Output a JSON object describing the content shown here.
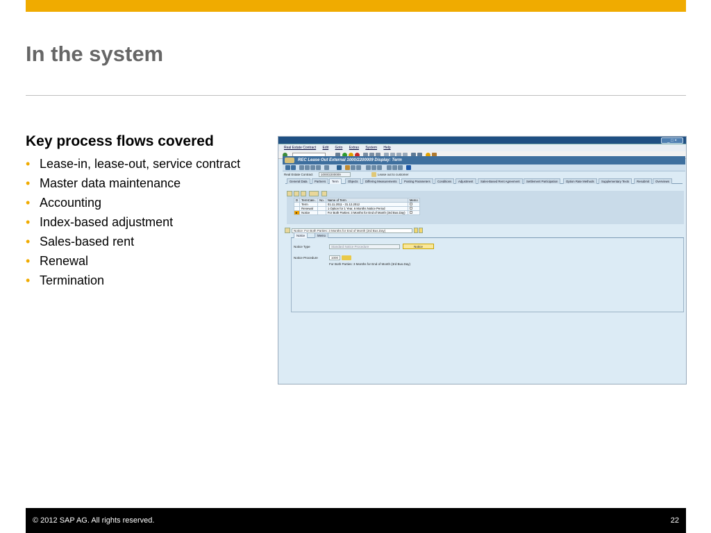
{
  "slide": {
    "title": "In the system",
    "section_title": "Key process flows covered",
    "bullets": [
      "Lease-in, lease-out, service contract",
      "Master data maintenance",
      "Accounting",
      "Index-based adjustment",
      "Sales-based rent",
      "Renewal",
      "Termination"
    ],
    "footer": {
      "copyright": "©  2012 SAP AG. All rights reserved.",
      "page": "22"
    },
    "colors": {
      "accent": "#f0ab00",
      "title": "#666666",
      "footer_bg": "#000000"
    }
  },
  "sap": {
    "menu": [
      "Real Estate Contract",
      "Edit",
      "Goto",
      "Extras",
      "System",
      "Help"
    ],
    "app_title": "REC Lease Out External 1000/2200009 Display: Term",
    "contract": {
      "label": "Real Estate Contract",
      "value": "1000/2200009",
      "description": "Lease out to customer"
    },
    "tabs": [
      "General Data",
      "Partners",
      "Term",
      "Objects",
      "Differing Measurements",
      "Posting Parameters",
      "Conditions",
      "Adjustment",
      "Sales-Based Rent Agreement",
      "Settlement Participation",
      "Option Rate Methods",
      "Supplementary Texts",
      "Resubmit",
      "Overviews"
    ],
    "active_tab": "Term",
    "table": {
      "headers": [
        "D",
        "TermCate..",
        "No.",
        "Name of Term",
        "Memo"
      ],
      "rows": [
        [
          "",
          "Term",
          "",
          "01.11.2011 - 31.12.2012",
          ""
        ],
        [
          "",
          "Renewal",
          "",
          "1 Option for 1 Year, 6 Months Notice Period",
          ""
        ],
        [
          "",
          "Notice",
          "",
          "For Both Parties: 3 Months for End of Month (3rd Bus.Day)",
          ""
        ]
      ]
    },
    "selector_value": "Notice: For Both Parties: 3 Months for End of Month (3rd Bus.Day)",
    "sub_tabs": [
      "Notice",
      "Memo"
    ],
    "notice_type": {
      "label": "Notice Type",
      "value": "Standard Notice Procedure",
      "button": "Notice"
    },
    "notice_procedure": {
      "label": "Notice Procedure",
      "value": "1000",
      "description": "For Both Parties: 3 Months for End of Month (3rd Bus.Day)"
    }
  }
}
